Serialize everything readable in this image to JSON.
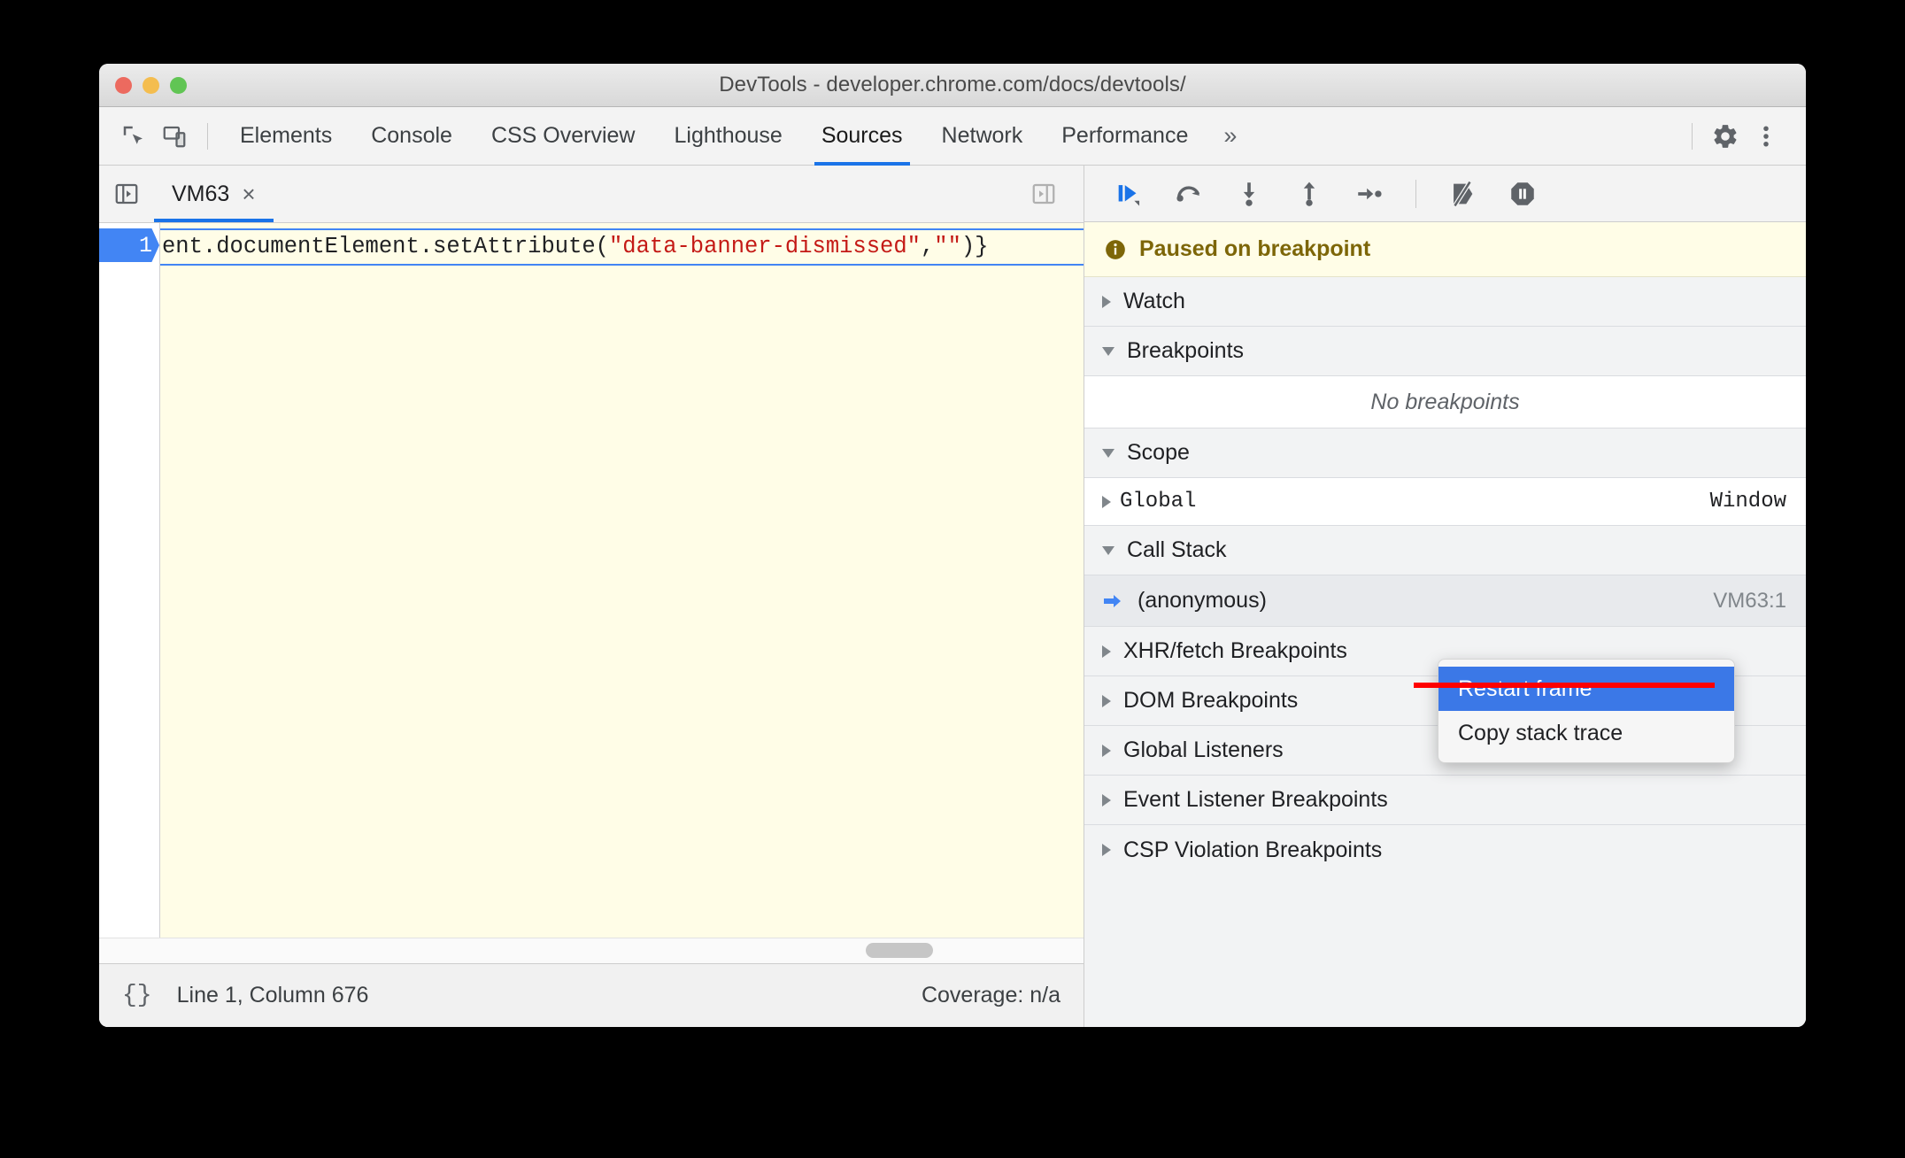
{
  "window": {
    "title": "DevTools - developer.chrome.com/docs/devtools/",
    "traffic_lights": [
      "close",
      "minimize",
      "zoom"
    ]
  },
  "toolbar": {
    "inspect_icon": "inspect-element-icon",
    "device_icon": "device-toolbar-icon",
    "tabs": [
      {
        "label": "Elements",
        "active": false
      },
      {
        "label": "Console",
        "active": false
      },
      {
        "label": "CSS Overview",
        "active": false
      },
      {
        "label": "Lighthouse",
        "active": false
      },
      {
        "label": "Sources",
        "active": true
      },
      {
        "label": "Network",
        "active": false
      },
      {
        "label": "Performance",
        "active": false
      }
    ],
    "more_tabs": "»",
    "settings_icon": "gear-icon",
    "menu_icon": "three-dot-menu-icon"
  },
  "file_tabs": {
    "navigator_toggle": "show-navigator-icon",
    "debugger_toggle": "show-debugger-icon",
    "tabs": [
      {
        "label": "VM63",
        "close": "×",
        "active": true
      }
    ]
  },
  "editor": {
    "line_number": "1",
    "code_prefix": "ent.documentElement.setAttribute(",
    "code_string1": "\"data-banner-dismissed\"",
    "code_comma": ",",
    "code_string2": "\"\"",
    "code_suffix": ")}"
  },
  "status_bar": {
    "pretty_print": "{}",
    "position": "Line 1, Column 676",
    "coverage": "Coverage: n/a"
  },
  "debugger_toolbar": {
    "buttons": [
      {
        "name": "resume-script-execution-icon",
        "title": "Resume"
      },
      {
        "name": "step-over-next-function-call-icon",
        "title": "Step over"
      },
      {
        "name": "step-into-next-function-call-icon",
        "title": "Step into"
      },
      {
        "name": "step-out-of-current-function-icon",
        "title": "Step out"
      },
      {
        "name": "step-icon",
        "title": "Step"
      },
      {
        "name": "deactivate-breakpoints-icon",
        "title": "Deactivate breakpoints"
      },
      {
        "name": "pause-on-exceptions-icon",
        "title": "Pause on exceptions"
      }
    ]
  },
  "paused_banner": {
    "icon": "info-icon",
    "text": "Paused on breakpoint"
  },
  "sidepanes": {
    "watch": {
      "label": "Watch",
      "expanded": false
    },
    "breakpoints": {
      "label": "Breakpoints",
      "expanded": true,
      "empty_text": "No breakpoints"
    },
    "scope": {
      "label": "Scope",
      "expanded": true,
      "rows": [
        {
          "name": "Global",
          "value": "Window",
          "expanded": false
        }
      ]
    },
    "call_stack": {
      "label": "Call Stack",
      "expanded": true,
      "frames": [
        {
          "name": "(anonymous)",
          "location": "VM63:1",
          "selected": true,
          "marker": "current-frame-arrow-icon"
        }
      ]
    },
    "other": [
      {
        "label": "XHR/fetch Breakpoints",
        "expanded": false
      },
      {
        "label": "DOM Breakpoints",
        "expanded": false
      },
      {
        "label": "Global Listeners",
        "expanded": false
      },
      {
        "label": "Event Listener Breakpoints",
        "expanded": false
      },
      {
        "label": "CSP Violation Breakpoints",
        "expanded": false
      }
    ]
  },
  "context_menu": {
    "items": [
      {
        "label": "Restart frame",
        "selected": true,
        "struck_through": true
      },
      {
        "label": "Copy stack trace",
        "selected": false,
        "struck_through": false
      }
    ]
  },
  "annotation": {
    "strike_color": "#ff0000"
  },
  "colors": {
    "accent": "#1a73e8",
    "highlight": "#3b78e7",
    "paused_bg": "#fffde7",
    "string_literal": "#c41a16",
    "selection_blue": "#4285f4"
  }
}
